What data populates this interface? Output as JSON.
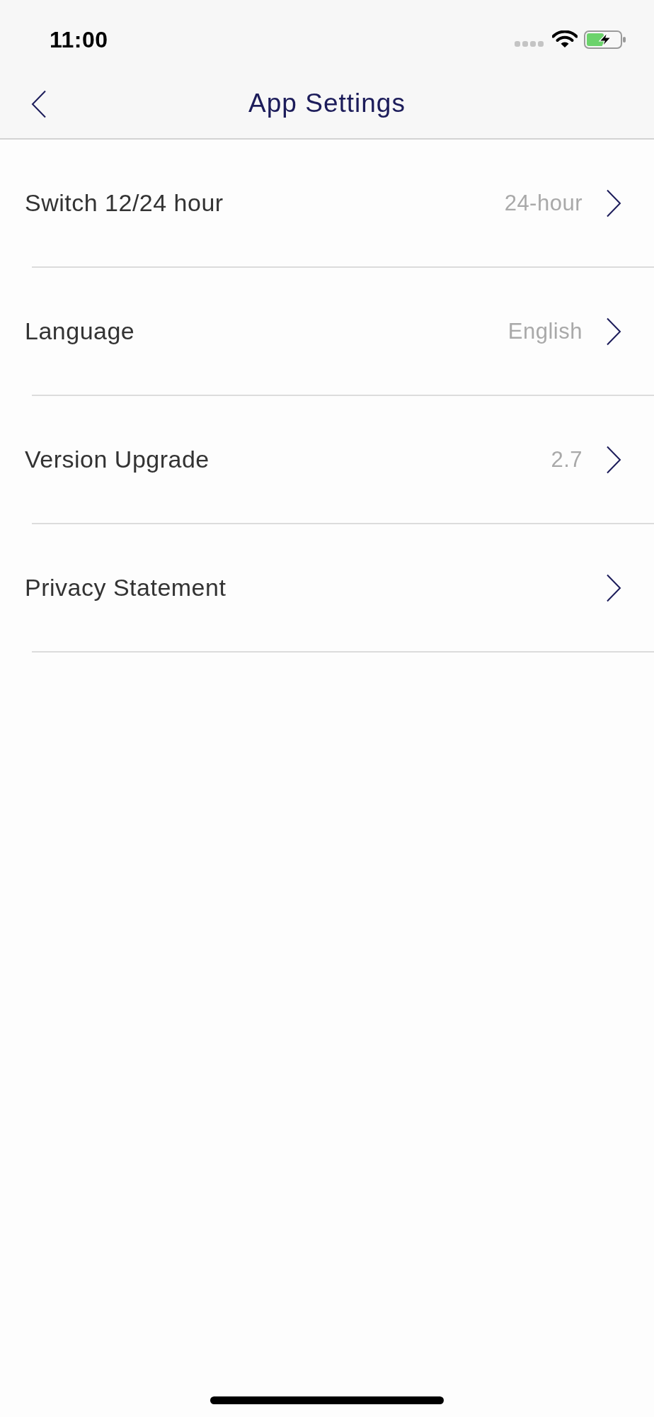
{
  "status_bar": {
    "time": "11:00"
  },
  "nav": {
    "title": "App Settings"
  },
  "settings": [
    {
      "label": "Switch 12/24 hour",
      "value": "24-hour"
    },
    {
      "label": "Language",
      "value": "English"
    },
    {
      "label": "Version Upgrade",
      "value": "2.7"
    },
    {
      "label": "Privacy Statement"
    }
  ]
}
